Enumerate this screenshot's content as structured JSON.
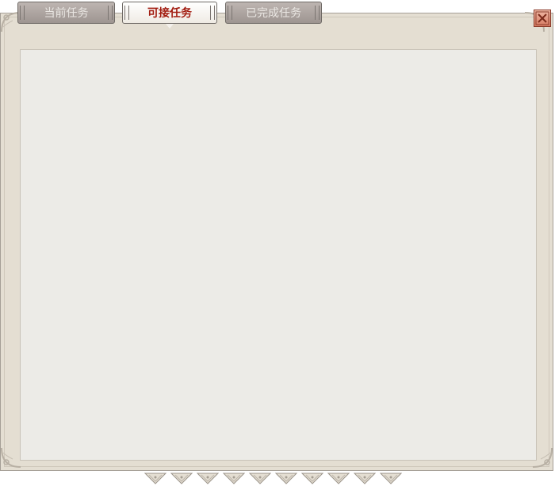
{
  "tabs": [
    {
      "label": "当前任务",
      "active": false
    },
    {
      "label": "可接任务",
      "active": true
    },
    {
      "label": "已完成任务",
      "active": false
    }
  ],
  "close_button": {
    "icon": "close-x-icon"
  },
  "pager": {
    "marker_count": 10,
    "icon": "chevron-down-icon"
  },
  "colors": {
    "frame": "#e4ded2",
    "content": "#ecebe7",
    "active_tab_text": "#a21c10",
    "inactive_tab_text": "#e9e6e2",
    "close_button": "#d77a62"
  }
}
